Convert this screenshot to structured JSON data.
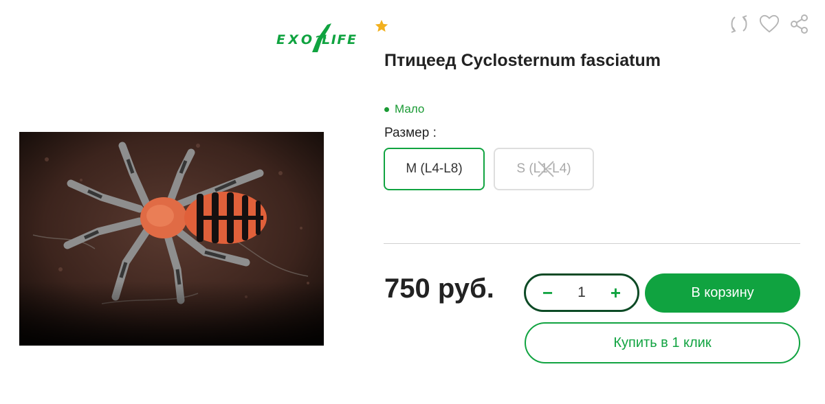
{
  "logo": {
    "text": "EXO LIFE",
    "color": "#10a340"
  },
  "product": {
    "title": "Птицеед Cyclosternum fasciatum",
    "stock": "Мало",
    "size_label": "Размер :",
    "sizes": [
      {
        "label": "M (L4-L8)",
        "state": "selected"
      },
      {
        "label": "S (L1-L4)",
        "state": "unavailable"
      }
    ],
    "price": "750 руб.",
    "quantity": "1"
  },
  "actions": {
    "minus": "−",
    "plus": "+",
    "add_to_cart": "В корзину",
    "buy_one_click": "Купить в 1 клик"
  },
  "icons": [
    "star-icon",
    "compare-icon",
    "heart-icon",
    "share-icon",
    "cross-icon"
  ],
  "colors": {
    "accent": "#10a340",
    "accent_dark": "#0c4a25",
    "star": "#f2b01e",
    "stock": "#1a9a34"
  }
}
